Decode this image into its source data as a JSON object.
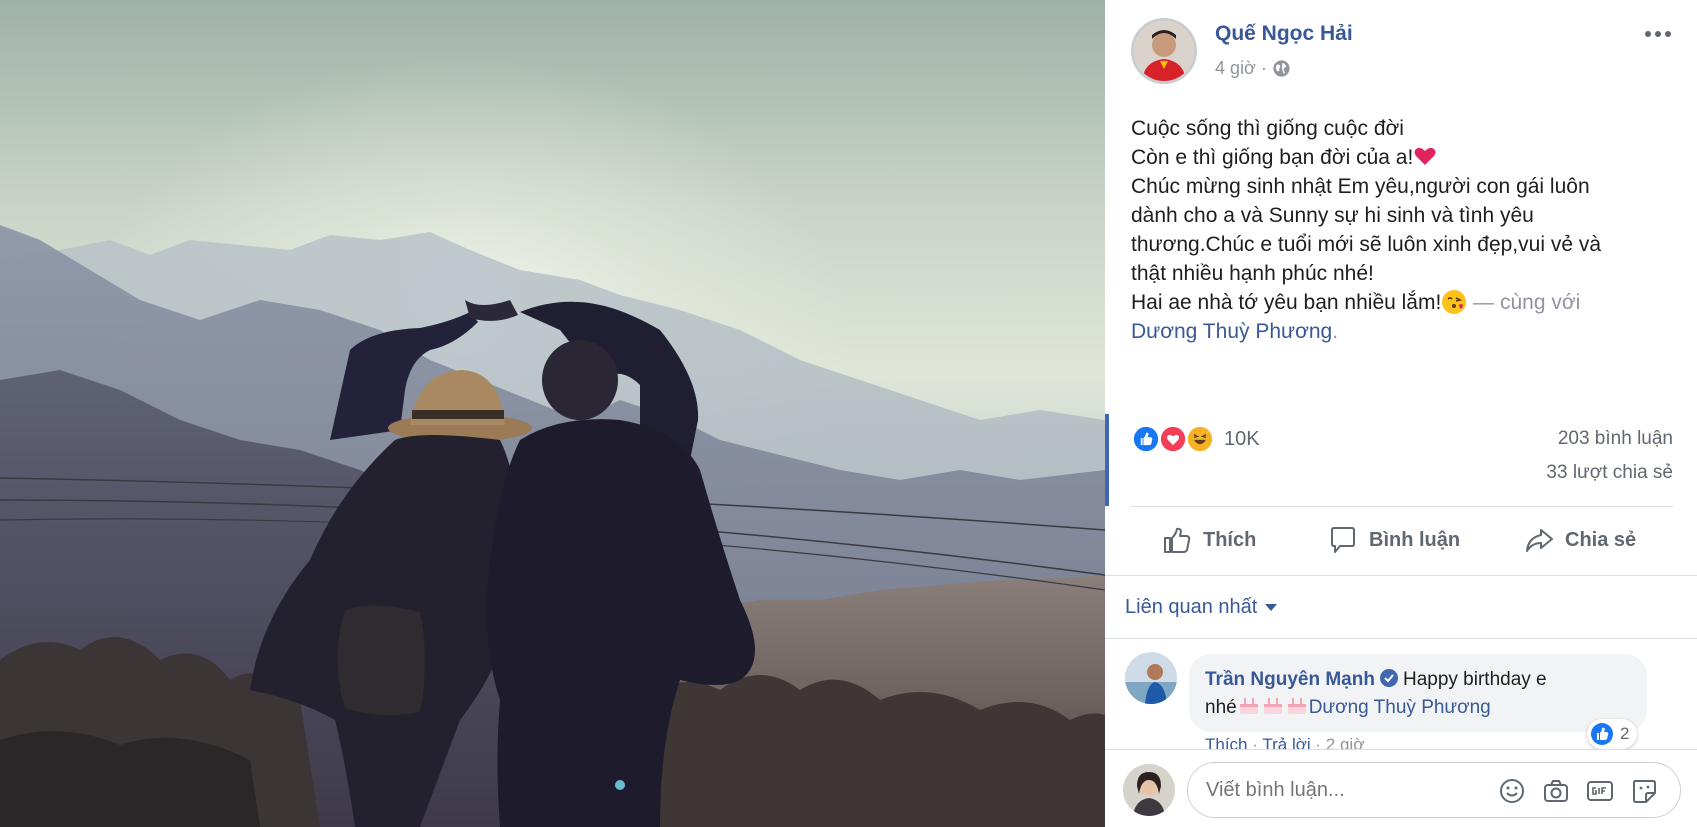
{
  "post": {
    "author": "Quế Ngọc Hải",
    "time": "4 giờ",
    "dot": "·",
    "lines": [
      "Cuộc sống thì giống cuộc đời",
      "Còn e thì giống bạn đời của a!",
      "Chúc mừng sinh nhật Em yêu,người con gái luôn",
      "dành cho a và Sunny sự hi sinh và tình yêu",
      "thương.Chúc e tuổi mới sẽ luôn xinh đẹp,vui vẻ và",
      "thật nhiều hạnh phúc nhé!",
      "Hai ae nhà tớ yêu bạn nhiều lắm!"
    ],
    "with_text": " — cùng với",
    "tagged": "Dương Thuỳ Phương",
    "tagged_end": ".",
    "icons": [
      "heart-emoji",
      "kiss-emoji",
      "globe-icon",
      "more-icon"
    ]
  },
  "stats": {
    "reactions": "10K",
    "reaction_types": [
      "like",
      "love",
      "haha"
    ],
    "comments": "203 bình luận",
    "shares": "33 lượt chia sẻ"
  },
  "actions": {
    "like": "Thích",
    "comment": "Bình luận",
    "share": "Chia sẻ"
  },
  "comments_section": {
    "sort_label": "Liên quan nhất",
    "items": [
      {
        "author": "Trần Nguyên Mạnh",
        "text_1": "Happy birthday e",
        "text_2": "nhé",
        "mention": "Dương Thuỳ Phương",
        "likes": "2",
        "like_action": "Thích",
        "reply_action": "Trả lời",
        "time": "2 giờ",
        "sep": "·"
      }
    ]
  },
  "composer": {
    "placeholder": "Viết bình luận..."
  },
  "colors": {
    "link": "#385898",
    "muted": "#90949c",
    "accent": "#4267b2",
    "like_blue": "#1877f2",
    "love_red": "#f33e58",
    "haha_yellow": "#f7b125"
  }
}
